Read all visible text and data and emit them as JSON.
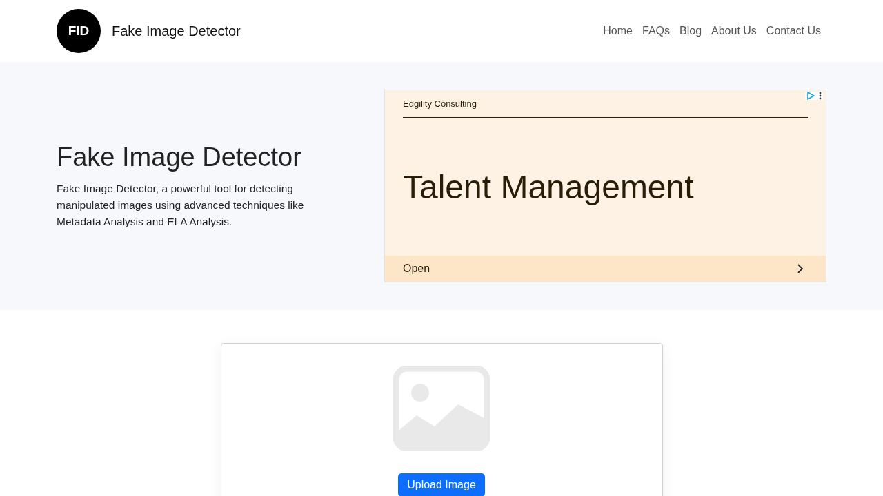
{
  "header": {
    "logo": "FID",
    "site_name": "Fake Image Detector",
    "nav": [
      {
        "label": "Home"
      },
      {
        "label": "FAQs"
      },
      {
        "label": "Blog"
      },
      {
        "label": "About Us"
      },
      {
        "label": "Contact Us"
      }
    ]
  },
  "hero": {
    "title": "Fake Image Detector",
    "description": "Fake Image Detector, a powerful tool for detecting manipulated images using advanced techniques like Metadata Analysis and ELA Analysis."
  },
  "ad": {
    "advertiser": "Edgility Consulting",
    "headline": "Talent Management",
    "cta": "Open"
  },
  "upload": {
    "button": "Upload Image"
  }
}
